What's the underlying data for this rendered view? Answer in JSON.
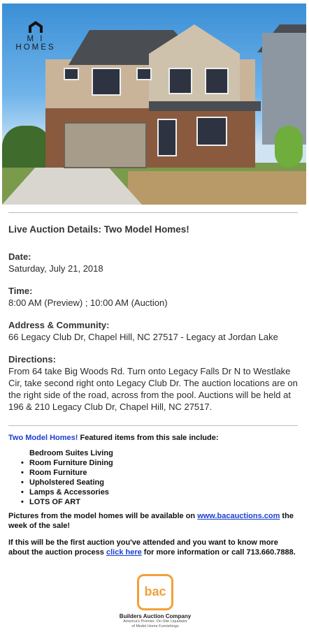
{
  "hero": {
    "brand": "M I HOMES"
  },
  "details": {
    "title": "Live Auction Details: Two Model Homes!",
    "date_label": "Date:",
    "date_value": "Saturday, July 21, 2018",
    "time_label": "Time:",
    "time_value": "8:00 AM (Preview) ; 10:00 AM (Auction)",
    "address_label": "Address & Community:",
    "address_value": "66 Legacy Club Dr, Chapel Hill, NC  27517 - Legacy at Jordan Lake",
    "directions_label": "Directions:",
    "directions_value": "From 64 take Big Woods Rd. Turn onto Legacy Falls Dr N to Westlake Cir, take second right onto Legacy Club Dr. The auction locations are on the right side of the road, across from the pool. Auctions will be held at 196 & 210 Legacy Club Dr, Chapel Hill, NC  27517."
  },
  "featured": {
    "highlight": "Two Model Homes!",
    "intro_rest": " Featured items from this sale include:",
    "items": [
      "Bedroom Suites Living",
      "Room Furniture Dining",
      "Room Furniture",
      "Upholstered Seating",
      "Lamps & Accessories",
      "LOTS OF ART"
    ],
    "pictures_pre": "Pictures from the model homes will be available on ",
    "pictures_link": "www.bacauctions.com",
    "pictures_post": " the week of the sale!",
    "first_pre": "If this will be the first auction you've attended and you want to know more about the auction process ",
    "first_link": "click here",
    "first_post": " for more information or call 713.660.7888."
  },
  "footer": {
    "logo_letters": "bac",
    "company": "Builders Auction Company",
    "tagline_1": "America's Premier, On-Site Liquidator",
    "tagline_2": "of Model Home Furnishings"
  },
  "colors": {
    "link": "#1a3fd1",
    "bac_orange": "#f0a13a"
  }
}
